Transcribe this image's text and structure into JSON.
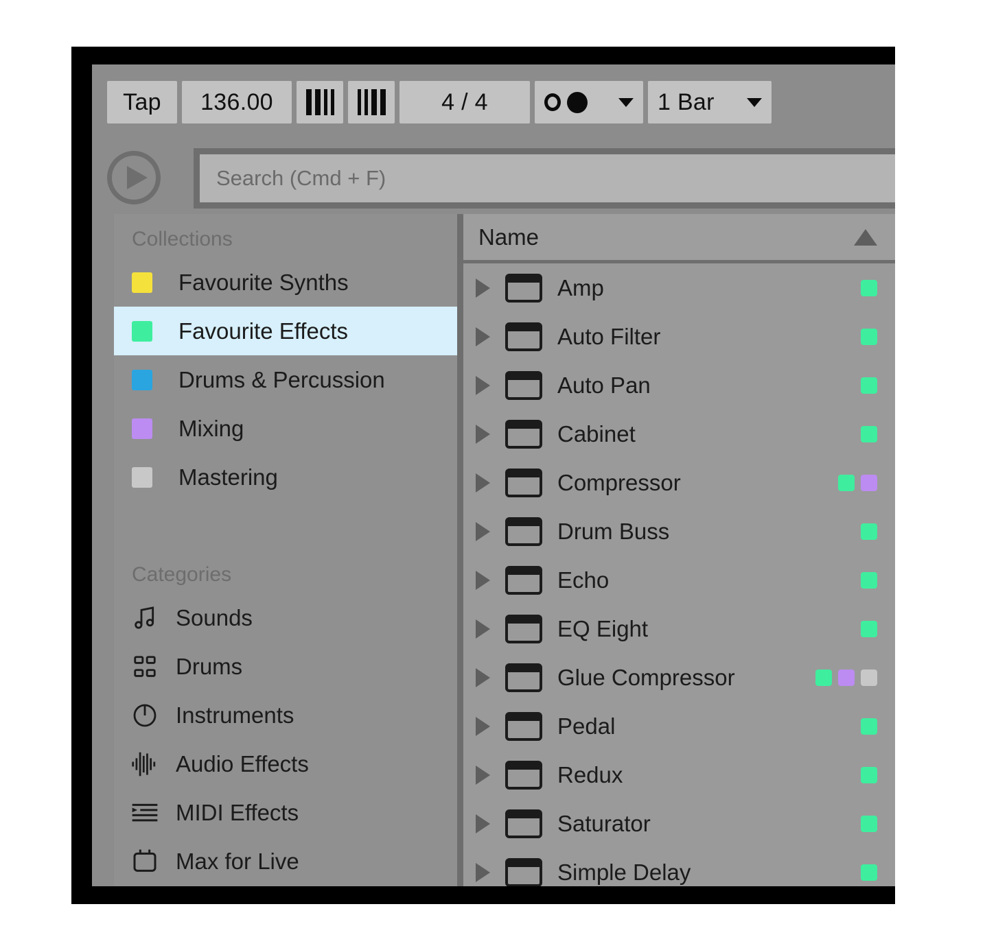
{
  "transport": {
    "tap_label": "Tap",
    "tempo_value": "136.00",
    "metronome_a_icon": "bars-icon",
    "metronome_b_icon": "bars-icon",
    "time_signature": "4 / 4",
    "record_quantization_icon": "circles-icon",
    "record_quantization_caret": "chevron-down-icon",
    "launch_quantization_value": "1 Bar",
    "launch_quantization_caret": "chevron-down-icon"
  },
  "browser": {
    "play_icon": "play-icon",
    "search": {
      "value": "",
      "placeholder": "Search (Cmd + F)"
    }
  },
  "sidebar": {
    "collections_title": "Collections",
    "collections": [
      {
        "label": "Favourite Synths",
        "color": "#f5e13c",
        "selected": false
      },
      {
        "label": "Favourite Effects",
        "color": "#3eee9e",
        "selected": true
      },
      {
        "label": "Drums & Percussion",
        "color": "#2aa5e0",
        "selected": false
      },
      {
        "label": "Mixing",
        "color": "#bc8cf2",
        "selected": false
      },
      {
        "label": "Mastering",
        "color": "#c8c8c8",
        "selected": false
      }
    ],
    "categories_title": "Categories",
    "categories": [
      {
        "label": "Sounds",
        "icon": "music-note-icon"
      },
      {
        "label": "Drums",
        "icon": "grid-four-icon"
      },
      {
        "label": "Instruments",
        "icon": "power-circle-icon"
      },
      {
        "label": "Audio Effects",
        "icon": "waveform-icon"
      },
      {
        "label": "MIDI Effects",
        "icon": "midi-lines-icon"
      },
      {
        "label": "Max for Live",
        "icon": "max-chip-icon"
      }
    ]
  },
  "device_list": {
    "header": {
      "name_label": "Name",
      "sort_icon": "sort-ascending-icon"
    },
    "rows": [
      {
        "name": "Amp",
        "expand_icon": "triangle-right-icon",
        "device_icon": "device-icon",
        "tags": [
          "#3eee9e"
        ]
      },
      {
        "name": "Auto Filter",
        "expand_icon": "triangle-right-icon",
        "device_icon": "device-icon",
        "tags": [
          "#3eee9e"
        ]
      },
      {
        "name": "Auto Pan",
        "expand_icon": "triangle-right-icon",
        "device_icon": "device-icon",
        "tags": [
          "#3eee9e"
        ]
      },
      {
        "name": "Cabinet",
        "expand_icon": "triangle-right-icon",
        "device_icon": "device-icon",
        "tags": [
          "#3eee9e"
        ]
      },
      {
        "name": "Compressor",
        "expand_icon": "triangle-right-icon",
        "device_icon": "device-icon",
        "tags": [
          "#3eee9e",
          "#bc8cf2"
        ]
      },
      {
        "name": "Drum Buss",
        "expand_icon": "triangle-right-icon",
        "device_icon": "device-icon",
        "tags": [
          "#3eee9e"
        ]
      },
      {
        "name": "Echo",
        "expand_icon": "triangle-right-icon",
        "device_icon": "device-icon",
        "tags": [
          "#3eee9e"
        ]
      },
      {
        "name": "EQ Eight",
        "expand_icon": "triangle-right-icon",
        "device_icon": "device-icon",
        "tags": [
          "#3eee9e"
        ]
      },
      {
        "name": "Glue Compressor",
        "expand_icon": "triangle-right-icon",
        "device_icon": "device-icon",
        "tags": [
          "#3eee9e",
          "#bc8cf2",
          "#c8c8c8"
        ]
      },
      {
        "name": "Pedal",
        "expand_icon": "triangle-right-icon",
        "device_icon": "device-icon",
        "tags": [
          "#3eee9e"
        ]
      },
      {
        "name": "Redux",
        "expand_icon": "triangle-right-icon",
        "device_icon": "device-icon",
        "tags": [
          "#3eee9e"
        ]
      },
      {
        "name": "Saturator",
        "expand_icon": "triangle-right-icon",
        "device_icon": "device-icon",
        "tags": [
          "#3eee9e"
        ]
      },
      {
        "name": "Simple Delay",
        "expand_icon": "triangle-right-icon",
        "device_icon": "device-icon",
        "tags": [
          "#3eee9e"
        ]
      }
    ]
  }
}
